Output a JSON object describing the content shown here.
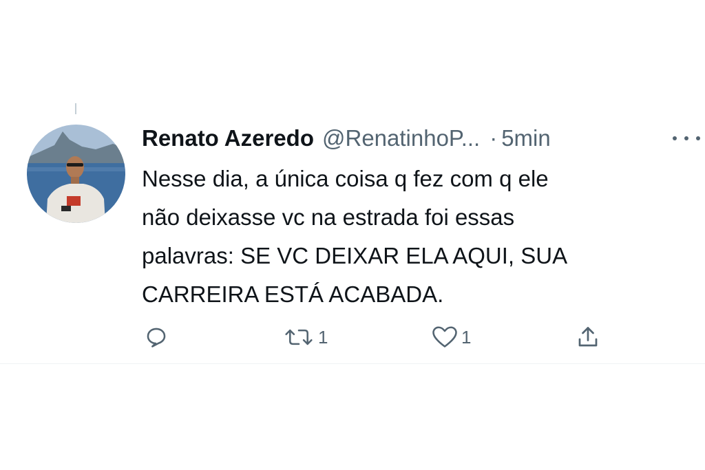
{
  "tweet": {
    "display_name": "Renato Azeredo",
    "handle": "@RenatinhoP...",
    "separator": "·",
    "time": "5min",
    "text_lines": [
      "Nesse dia, a única coisa q fez com q ele",
      "não deixasse vc na estrada foi essas",
      "palavras: SE VC DEIXAR ELA AQUI, SUA",
      "CARREIRA ESTÁ ACABADA."
    ]
  },
  "actions": {
    "reply": {
      "icon": "reply-icon",
      "count": ""
    },
    "retweet": {
      "icon": "retweet-icon",
      "count": "1"
    },
    "like": {
      "icon": "heart-icon",
      "count": "1"
    },
    "share": {
      "icon": "share-icon",
      "count": ""
    }
  },
  "icons": {
    "more": "more-options-icon"
  },
  "colors": {
    "text": "#0f1419",
    "secondary": "#536471",
    "divider": "#eff3f4"
  }
}
